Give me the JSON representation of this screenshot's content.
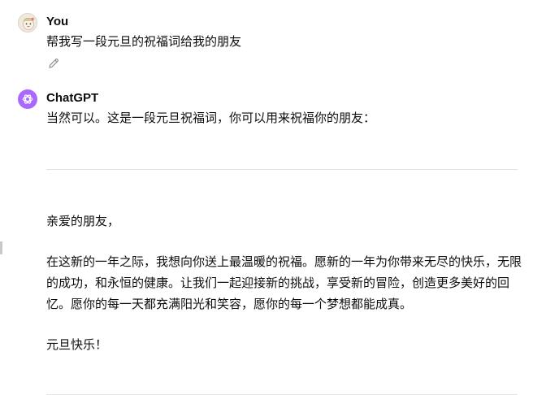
{
  "user_message": {
    "author": "You",
    "text": "帮我写一段元旦的祝福词给我的朋友",
    "avatar_icon": "user-avatar-icon",
    "edit_icon": "pencil-icon"
  },
  "assistant_message": {
    "author": "ChatGPT",
    "intro": "当然可以。这是一段元旦祝福词，你可以用来祝福你的朋友：",
    "avatar_icon": "openai-logo-icon",
    "accent_color": "#ab68ff",
    "letter": {
      "greeting": "亲爱的朋友，",
      "body": "在这新的一年之际，我想向你送上最温暖的祝福。愿新的一年为你带来无尽的快乐，无限的成功，和永恒的健康。让我们一起迎接新的挑战，享受新的冒险，创造更多美好的回忆。愿你的每一天都充满阳光和笑容，愿你的每一个梦想都能成真。",
      "closing": "元旦快乐！"
    }
  }
}
